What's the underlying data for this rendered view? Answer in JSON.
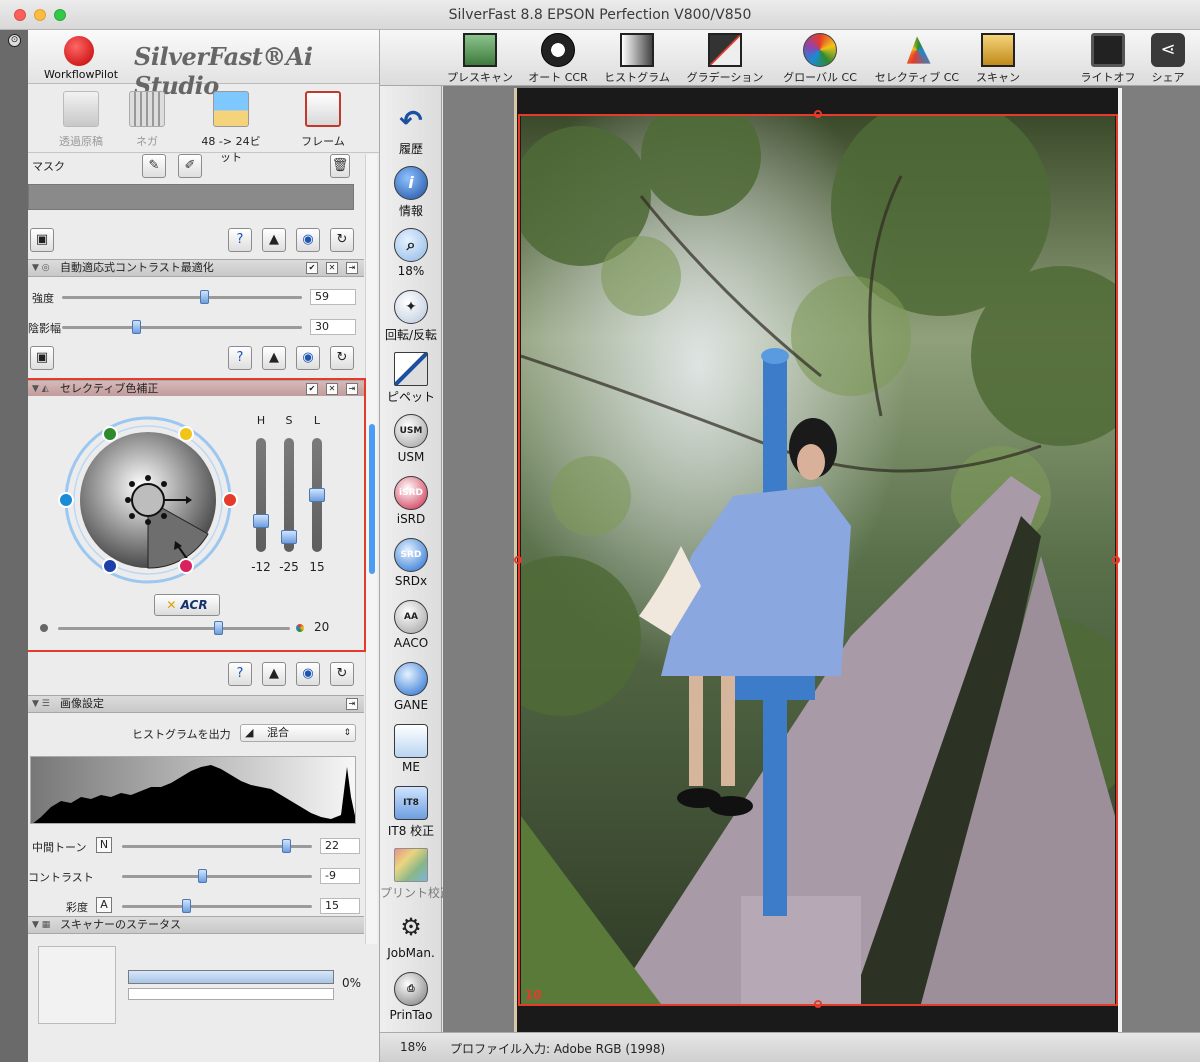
{
  "window": {
    "title": "SilverFast 8.8 EPSON Perfection V800/V850"
  },
  "brand": {
    "workflow_label": "WorkflowPilot",
    "app_name": "SilverFast®Ai Studio"
  },
  "modes": [
    {
      "label": "透過原稿",
      "dim": true
    },
    {
      "label": "ネガ",
      "dim": true
    },
    {
      "label": "48 -> 24ビット",
      "dim": false
    },
    {
      "label": "フレーム",
      "dim": false
    }
  ],
  "mask": {
    "label": "マスク"
  },
  "auto_contrast": {
    "title": "自動適応式コントラスト最適化",
    "strength_label": "強度",
    "strength_value": "59",
    "strength_pos": 0.59,
    "shadow_label": "陰影幅",
    "shadow_value": "30",
    "shadow_pos": 0.3
  },
  "selective": {
    "title": "セレクティブ色補正",
    "h_label": "H",
    "s_label": "S",
    "l_label": "L",
    "h_value": "-12",
    "s_value": "-25",
    "l_value": "15",
    "acr_label": "ACR",
    "saturation_value": "20"
  },
  "image_settings": {
    "title": "画像設定",
    "hist_output_label": "ヒストグラムを出力",
    "hist_mode": "混合",
    "midtone_label": "中間トーン",
    "midtone_btn": "N",
    "midtone_value": "22",
    "contrast_label": "コントラスト",
    "contrast_value": "-9",
    "saturation_label": "彩度",
    "saturation_btn": "A",
    "saturation_value": "15"
  },
  "scanner_status": {
    "title": "スキャナーのステータス",
    "progress": "0%"
  },
  "toolbar": [
    {
      "label": "プレスキャン"
    },
    {
      "label": "オート CCR"
    },
    {
      "label": "ヒストグラム"
    },
    {
      "label": "グラデーション"
    },
    {
      "label": "グローバル CC"
    },
    {
      "label": "セレクティブ CC"
    },
    {
      "label": "スキャン"
    },
    {
      "label": "ライトオフ"
    },
    {
      "label": "シェア"
    }
  ],
  "vtools": [
    {
      "label": "履歴"
    },
    {
      "label": "情報"
    },
    {
      "label": "18%"
    },
    {
      "label": "回転/反転"
    },
    {
      "label": "ピペット"
    },
    {
      "label": "USM"
    },
    {
      "label": "iSRD"
    },
    {
      "label": "SRDx"
    },
    {
      "label": "AACO"
    },
    {
      "label": "GANE"
    },
    {
      "label": "ME"
    },
    {
      "label": "IT8 校正"
    },
    {
      "label": "プリント校正"
    },
    {
      "label": "JobMan."
    },
    {
      "label": "PrinTao"
    }
  ],
  "preview": {
    "frame_number": "10"
  },
  "statusbar": {
    "zoom": "18%",
    "profile": "プロファイル入力: Adobe RGB (1998)"
  },
  "colors": {
    "accent_red": "#e53b2a",
    "knob_blue": "#6d9ee0",
    "scroll_blue": "#4a9cf5"
  }
}
